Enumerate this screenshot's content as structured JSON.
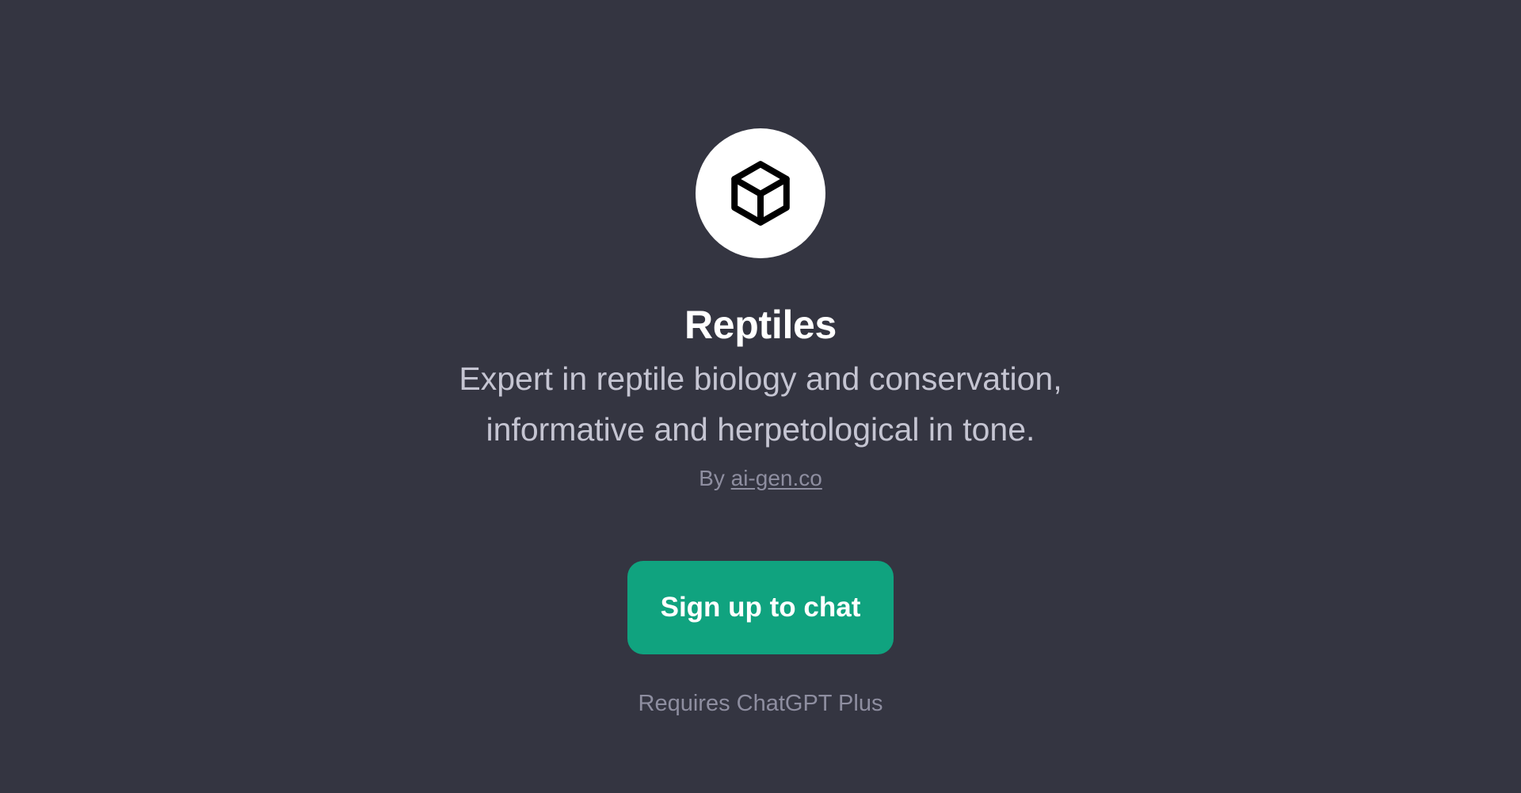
{
  "gpt": {
    "avatar_icon": "cube-icon",
    "name": "Reptiles",
    "description_line1": "Expert in reptile biology and conservation,",
    "description_line2": "informative and herpetological in tone.",
    "byline_prefix": "By",
    "author": "ai-gen.co"
  },
  "actions": {
    "signup_label": "Sign up to chat",
    "requirement_text": "Requires ChatGPT Plus"
  },
  "colors": {
    "background": "#343541",
    "accent": "#10a37f",
    "title": "#ffffff",
    "description": "#c5c5d2",
    "muted": "#8e8ea0"
  }
}
